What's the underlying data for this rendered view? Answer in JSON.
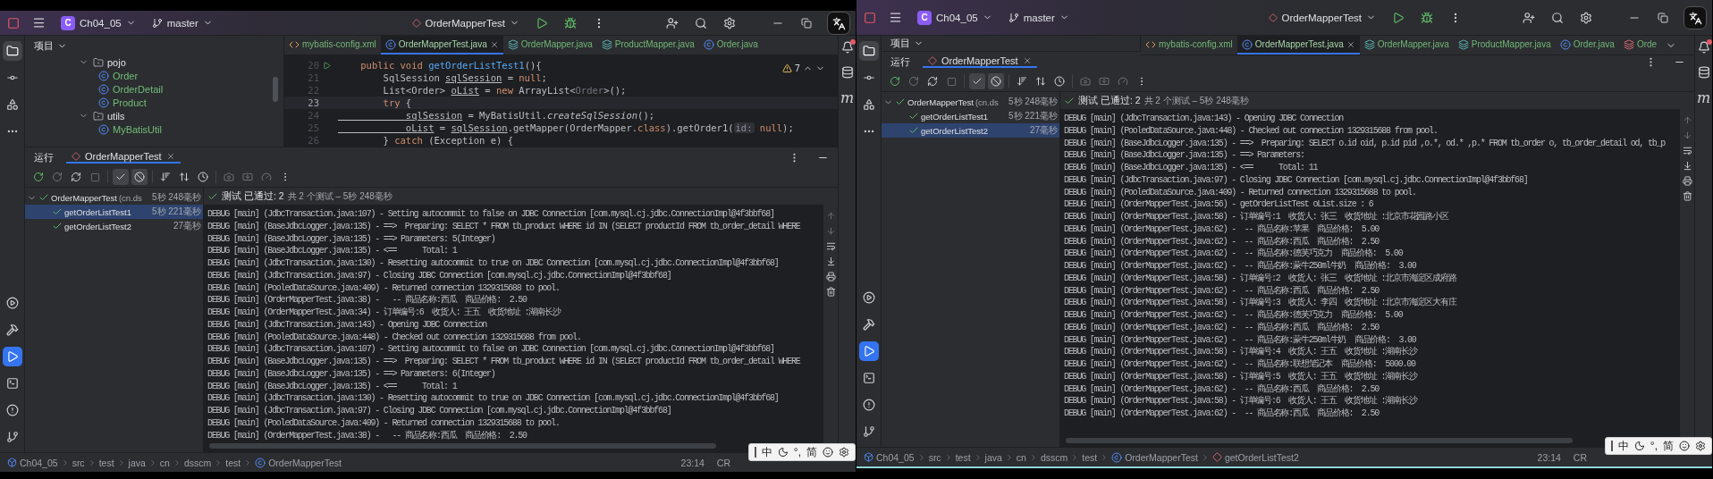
{
  "windows": [
    {
      "title_bar": {
        "project_badge": "C",
        "project": "Ch04_05",
        "branch": "master",
        "run_config": "OrderMapperTest"
      },
      "tool_strip": {
        "top": [
          {
            "kind": "project",
            "selected": true
          },
          {
            "kind": "commit",
            "selected": false
          },
          {
            "kind": "structure",
            "selected": false
          },
          {
            "kind": "more",
            "selected": false
          }
        ],
        "bottom": [
          {
            "kind": "services",
            "selected": false
          },
          {
            "kind": "build",
            "selected": false
          },
          {
            "kind": "run",
            "selected": true
          },
          {
            "kind": "terminal",
            "selected": false
          },
          {
            "kind": "problems",
            "selected": false
          },
          {
            "kind": "git",
            "selected": false
          }
        ]
      },
      "right_strip": {
        "badge": "m",
        "notification": true
      },
      "project_panel": {
        "title": "项目",
        "tree": [
          {
            "label": "pojo",
            "kind": "package",
            "expanded": true,
            "children": [
              {
                "label": "Order",
                "kind": "class"
              },
              {
                "label": "OrderDetail",
                "kind": "class"
              },
              {
                "label": "Product",
                "kind": "class"
              }
            ]
          },
          {
            "label": "utils",
            "kind": "package",
            "expanded": true,
            "children": [
              {
                "label": "MyBatisUtil",
                "kind": "class"
              }
            ]
          }
        ]
      },
      "editor": {
        "tabs": [
          {
            "label": "mybatis-config.xml",
            "kind": "xml",
            "selected": false
          },
          {
            "label": "OrderMapperTest.java",
            "kind": "class",
            "selected": true
          },
          {
            "label": "OrderMapper.java",
            "kind": "mapper",
            "selected": false
          },
          {
            "label": "ProductMapper.java",
            "kind": "mapper",
            "selected": false
          },
          {
            "label": "Order.java",
            "kind": "class",
            "selected": false
          }
        ],
        "warnings": "7",
        "code": [
          {
            "number": "20",
            "current": false,
            "run_marker": true,
            "tokens": [
              {
                "kind": "kw",
                "text": "    public void "
              },
              {
                "kind": "decl",
                "text": "getOrderListTest1"
              },
              {
                "kind": "plain",
                "text": "(){"
              }
            ]
          },
          {
            "number": "21",
            "current": false,
            "tokens": [
              {
                "kind": "plain",
                "text": "        SqlSession "
              },
              {
                "kind": "ul",
                "text": "sqlSession"
              },
              {
                "kind": "plain",
                "text": " = "
              },
              {
                "kind": "kw",
                "text": "null"
              },
              {
                "kind": "plain",
                "text": ";"
              }
            ]
          },
          {
            "number": "22",
            "current": false,
            "tokens": [
              {
                "kind": "plain",
                "text": "        List<Order> "
              },
              {
                "kind": "ul",
                "text": "oList"
              },
              {
                "kind": "plain",
                "text": " = "
              },
              {
                "kind": "kw",
                "text": "new "
              },
              {
                "kind": "plain",
                "text": "ArrayList<"
              },
              {
                "kind": "dim",
                "text": "Order"
              },
              {
                "kind": "plain",
                "text": ">();"
              }
            ]
          },
          {
            "number": "23",
            "current": true,
            "tokens": [
              {
                "kind": "kw",
                "text": "        try"
              },
              {
                "kind": "plain",
                "text": " {"
              }
            ]
          },
          {
            "number": "24",
            "current": false,
            "tokens": [
              {
                "kind": "ul",
                "text": "            sqlSession"
              },
              {
                "kind": "plain",
                "text": " = MyBatisUtil."
              },
              {
                "kind": "italic",
                "text": "createSqlSession"
              },
              {
                "kind": "plain",
                "text": "();"
              }
            ]
          },
          {
            "number": "25",
            "current": false,
            "tokens": [
              {
                "kind": "ul",
                "text": "            oList"
              },
              {
                "kind": "plain",
                "text": " = "
              },
              {
                "kind": "ul",
                "text": "sqlSession"
              },
              {
                "kind": "plain",
                "text": ".getMapper(OrderMapper."
              },
              {
                "kind": "kw",
                "text": "class"
              },
              {
                "kind": "plain",
                "text": ").getOrder1("
              },
              {
                "kind": "hint",
                "text": "id:"
              },
              {
                "kind": "kw",
                "text": " null"
              },
              {
                "kind": "plain",
                "text": ");"
              }
            ]
          },
          {
            "number": "26",
            "current": false,
            "tokens": [
              {
                "kind": "plain",
                "text": "        } "
              },
              {
                "kind": "kw",
                "text": "catch"
              },
              {
                "kind": "plain",
                "text": " (Exception e) {"
              }
            ]
          }
        ]
      },
      "run_panel": {
        "title": "运行",
        "tabs": [
          {
            "label": "OrderMapperTest",
            "selected": true
          }
        ],
        "toggles": [
          {
            "kind": "passed",
            "on": true
          },
          {
            "kind": "ignored",
            "on": true
          }
        ],
        "tree": [
          {
            "label": "OrderMapperTest",
            "detail": "(cn.ds",
            "time": "5秒 248毫秒",
            "selected": false,
            "expanded": true,
            "children": [
              {
                "label": "getOrderListTest1",
                "time": "5秒 221毫秒",
                "selected": true
              },
              {
                "label": "getOrderListTest2",
                "time": "27毫秒",
                "selected": false
              }
            ]
          }
        ],
        "summary": "测试 已通过: 2",
        "summary_detail": "共 2 个测试 – 5秒 248毫秒",
        "console": [
          "DEBUG [main] (JdbcTransaction.java:107) - Setting autocommit to false on JDBC Connection [com.mysql.cj.jdbc.ConnectionImpl@4f3bbf68]",
          "DEBUG [main] (BaseJdbcLogger.java:135) - ==>  Preparing: SELECT * FROM tb_product WHERE id IN (SELECT productId FROM tb_order_detail WHERE",
          "DEBUG [main] (BaseJdbcLogger.java:135) - ==> Parameters: 5(Integer)",
          "DEBUG [main] (BaseJdbcLogger.java:135) - <==      Total: 1",
          "DEBUG [main] (JdbcTransaction.java:130) - Resetting autocommit to true on JDBC Connection [com.mysql.cj.jdbc.ConnectionImpl@4f3bbf68]",
          "DEBUG [main] (JdbcTransaction.java:97) - Closing JDBC Connection [com.mysql.cj.jdbc.ConnectionImpl@4f3bbf68]",
          "DEBUG [main] (PooledDataSource.java:409) - Returned connection 1329315688 to pool.",
          "DEBUG [main] (OrderMapperTest.java:38) -   -- 商品名称:西瓜  商品价格:  2.50",
          "DEBUG [main] (OrderMapperTest.java:34) - 订单编号:6  收货人: 王五  收货地址 :湖南长沙",
          "DEBUG [main] (JdbcTransaction.java:143) - Opening JDBC Connection",
          "DEBUG [main] (PooledDataSource.java:448) - Checked out connection 1329315688 from pool.",
          "DEBUG [main] (JdbcTransaction.java:107) - Setting autocommit to false on JDBC Connection [com.mysql.cj.jdbc.ConnectionImpl@4f3bbf68]",
          "DEBUG [main] (BaseJdbcLogger.java:135) - ==>  Preparing: SELECT * FROM tb_product WHERE id IN (SELECT productId FROM tb_order_detail WHERE",
          "DEBUG [main] (BaseJdbcLogger.java:135) - ==> Parameters: 6(Integer)",
          "DEBUG [main] (BaseJdbcLogger.java:135) - <==      Total: 1",
          "DEBUG [main] (JdbcTransaction.java:130) - Resetting autocommit to true on JDBC Connection [com.mysql.cj.jdbc.ConnectionImpl@4f3bbf68]",
          "DEBUG [main] (JdbcTransaction.java:97) - Closing JDBC Connection [com.mysql.cj.jdbc.ConnectionImpl@4f3bbf68]",
          "DEBUG [main] (PooledDataSource.java:409) - Returned connection 1329315688 to pool.",
          "DEBUG [main] (OrderMapperTest.java:38) -   -- 商品名称:西瓜  商品价格:  2.50"
        ]
      },
      "status_bar": {
        "breadcrumbs": [
          {
            "label": "Ch04_05",
            "kind": "module"
          },
          {
            "label": "src",
            "kind": "folder"
          },
          {
            "label": "test",
            "kind": "folder"
          },
          {
            "label": "java",
            "kind": "folder"
          },
          {
            "label": "cn",
            "kind": "folder"
          },
          {
            "label": "dsscm",
            "kind": "folder"
          },
          {
            "label": "test",
            "kind": "folder"
          },
          {
            "label": "OrderMapperTest",
            "kind": "class"
          }
        ],
        "position": "23:14",
        "line_separator": "CR"
      },
      "ime_bar": [
        {
          "kind": "text",
          "label": "中"
        },
        {
          "kind": "moon"
        },
        {
          "kind": "text",
          "label": "°,"
        },
        {
          "kind": "text",
          "label": "简"
        },
        {
          "kind": "smile"
        },
        {
          "kind": "gear"
        }
      ]
    },
    {
      "title_bar": {
        "project_badge": "C",
        "project": "Ch04_05",
        "branch": "master",
        "run_config": "OrderMapperTest"
      },
      "tool_strip": {
        "top": [
          {
            "kind": "project",
            "selected": true
          },
          {
            "kind": "commit",
            "selected": false
          },
          {
            "kind": "structure",
            "selected": false
          },
          {
            "kind": "more",
            "selected": false
          }
        ],
        "bottom": [
          {
            "kind": "services",
            "selected": false
          },
          {
            "kind": "build",
            "selected": false
          },
          {
            "kind": "run",
            "selected": true
          },
          {
            "kind": "terminal",
            "selected": false
          },
          {
            "kind": "problems",
            "selected": false
          },
          {
            "kind": "git",
            "selected": false
          }
        ]
      },
      "right_strip": {
        "badge": "m",
        "notification": true
      },
      "project_panel": {
        "title": "项目"
      },
      "editor": {
        "tabs": [
          {
            "label": "mybatis-config.xml",
            "kind": "xml",
            "selected": false
          },
          {
            "label": "OrderMapperTest.java",
            "kind": "class",
            "selected": true
          },
          {
            "label": "OrderMapper.java",
            "kind": "mapper",
            "selected": false
          },
          {
            "label": "ProductMapper.java",
            "kind": "mapper",
            "selected": false
          },
          {
            "label": "Order.java",
            "kind": "class",
            "selected": false
          },
          {
            "label": "Orde",
            "kind": "other",
            "selected": false
          }
        ]
      },
      "run_panel": {
        "title": "运行",
        "tabs": [
          {
            "label": "OrderMapperTest",
            "selected": true
          }
        ],
        "toggles": [
          {
            "kind": "passed",
            "on": true
          },
          {
            "kind": "ignored",
            "on": true
          }
        ],
        "tree": [
          {
            "label": "OrderMapperTest",
            "detail": "(cn.ds",
            "time": "5秒 248毫秒",
            "selected": false,
            "expanded": true,
            "children": [
              {
                "label": "getOrderListTest1",
                "time": "5秒 221毫秒",
                "selected": false
              },
              {
                "label": "getOrderListTest2",
                "time": "27毫秒",
                "selected": true
              }
            ]
          }
        ],
        "summary": "测试 已通过: 2",
        "summary_detail": "共 2 个测试 – 5秒 248毫秒",
        "console": [
          "DEBUG [main] (JdbcTransaction.java:143) - Opening JDBC Connection",
          "DEBUG [main] (PooledDataSource.java:448) - Checked out connection 1329315688 from pool.",
          "DEBUG [main] (BaseJdbcLogger.java:135) - ==>  Preparing: SELECT o.id oid, p.id pid ,o.*, od.* ,p.* FROM tb_order o, tb_order_detail od, tb_p",
          "DEBUG [main] (BaseJdbcLogger.java:135) - ==> Parameters:",
          "DEBUG [main] (BaseJdbcLogger.java:135) - <==      Total: 11",
          "DEBUG [main] (JdbcTransaction.java:97) - Closing JDBC Connection [com.mysql.cj.jdbc.ConnectionImpl@4f3bbf68]",
          "DEBUG [main] (PooledDataSource.java:409) - Returned connection 1329315688 to pool.",
          "DEBUG [main] (OrderMapperTest.java:56) - getOrderListTest oList.size : 6",
          "DEBUG [main] (OrderMapperTest.java:58) - 订单编号:1  收货人: 张三  收货地址 :北京市花园路小区",
          "DEBUG [main] (OrderMapperTest.java:62) -  -- 商品名称:苹果  商品价格:  5.00",
          "DEBUG [main] (OrderMapperTest.java:62) -  -- 商品名称:西瓜  商品价格:  2.50",
          "DEBUG [main] (OrderMapperTest.java:62) -  -- 商品名称:德芙巧克力  商品价格:  5.00",
          "DEBUG [main] (OrderMapperTest.java:62) -  -- 商品名称:蒙牛250ml牛奶  商品价格:  3.00",
          "DEBUG [main] (OrderMapperTest.java:58) - 订单编号:2  收货人: 张三  收货地址 :北京市海淀区成府路",
          "DEBUG [main] (OrderMapperTest.java:62) -  -- 商品名称:西瓜  商品价格:  2.50",
          "DEBUG [main] (OrderMapperTest.java:58) - 订单编号:3  收货人: 李四  收货地址 :北京市海淀区大有庄",
          "DEBUG [main] (OrderMapperTest.java:62) -  -- 商品名称:德芙巧克力  商品价格:  5.00",
          "DEBUG [main] (OrderMapperTest.java:62) -  -- 商品名称:西瓜  商品价格:  2.50",
          "DEBUG [main] (OrderMapperTest.java:62) -  -- 商品名称:蒙牛250ml牛奶  商品价格:  3.00",
          "DEBUG [main] (OrderMapperTest.java:58) - 订单编号:4  收货人: 王五  收货地址 :湖南长沙",
          "DEBUG [main] (OrderMapperTest.java:62) -  -- 商品名称:联想笔记本  商品价格:  5000.00",
          "DEBUG [main] (OrderMapperTest.java:58) - 订单编号:5  收货人: 王五  收货地址 :湖南长沙",
          "DEBUG [main] (OrderMapperTest.java:62) -  -- 商品名称:西瓜  商品价格:  2.50",
          "DEBUG [main] (OrderMapperTest.java:58) - 订单编号:6  收货人: 王五  收货地址 :湖南长沙",
          "DEBUG [main] (OrderMapperTest.java:62) -  -- 商品名称:西瓜  商品价格:  2.50"
        ]
      },
      "status_bar": {
        "breadcrumbs": [
          {
            "label": "Ch04_05",
            "kind": "module"
          },
          {
            "label": "src",
            "kind": "folder"
          },
          {
            "label": "test",
            "kind": "folder"
          },
          {
            "label": "java",
            "kind": "folder"
          },
          {
            "label": "cn",
            "kind": "folder"
          },
          {
            "label": "dsscm",
            "kind": "folder"
          },
          {
            "label": "test",
            "kind": "folder"
          },
          {
            "label": "OrderMapperTest",
            "kind": "class"
          },
          {
            "label": "getOrderListTest2",
            "kind": "method"
          }
        ],
        "position": "23:14",
        "line_separator": "CR"
      },
      "ime_bar": [
        {
          "kind": "text",
          "label": "中"
        },
        {
          "kind": "moon"
        },
        {
          "kind": "text",
          "label": "°,"
        },
        {
          "kind": "text",
          "label": "简"
        },
        {
          "kind": "smile"
        },
        {
          "kind": "gear"
        }
      ]
    }
  ]
}
